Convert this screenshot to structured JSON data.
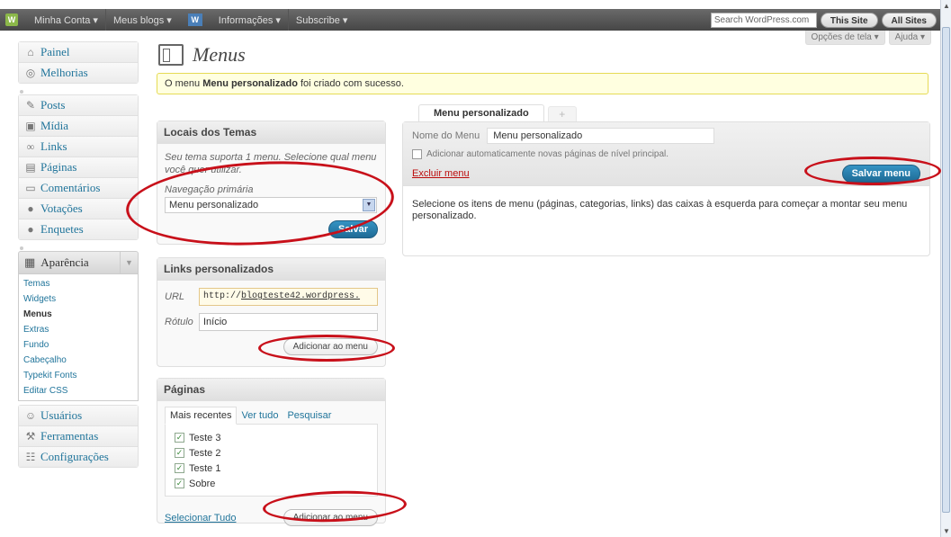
{
  "adminbar": {
    "items": [
      "Minha Conta ▾",
      "Meus blogs ▾",
      "Informações ▾",
      "Subscribe ▾"
    ],
    "search_placeholder": "Search WordPress.com",
    "this_site": "This Site",
    "all_sites": "All Sites"
  },
  "screen_options": {
    "opts": "Opções de tela ▾",
    "help": "Ajuda ▾"
  },
  "sidebar": {
    "group1": [
      "Painel",
      "Melhorias"
    ],
    "group2": [
      "Posts",
      "Mídia",
      "Links",
      "Páginas",
      "Comentários",
      "Votações",
      "Enquetes"
    ],
    "appearance": "Aparência",
    "submenu": [
      "Temas",
      "Widgets",
      "Menus",
      "Extras",
      "Fundo",
      "Cabeçalho",
      "Typekit Fonts",
      "Editar CSS"
    ],
    "group3": [
      "Usuários",
      "Ferramentas",
      "Configurações"
    ]
  },
  "page": {
    "title": "Menus",
    "notice_pre": "O menu ",
    "notice_bold": "Menu personalizado",
    "notice_post": " foi criado com sucesso."
  },
  "locations": {
    "title": "Locais dos Temas",
    "desc": "Seu tema suporta 1 menu. Selecione qual menu você quer utilizar.",
    "label": "Navegação primária",
    "selected": "Menu personalizado",
    "save": "Salvar"
  },
  "custom_links": {
    "title": "Links personalizados",
    "url_label": "URL",
    "url_prefix": "http://",
    "url_link": "blogteste42.wordpress.",
    "label_label": "Rótulo",
    "label_value": "Início",
    "add": "Adicionar ao menu"
  },
  "pages_box": {
    "title": "Páginas",
    "tabs": [
      "Mais recentes",
      "Ver tudo",
      "Pesquisar"
    ],
    "items": [
      "Teste 3",
      "Teste 2",
      "Teste 1",
      "Sobre"
    ],
    "select_all": "Selecionar Tudo",
    "add": "Adicionar ao menu"
  },
  "menu_editor": {
    "tab": "Menu personalizado",
    "plus": "+",
    "name_label": "Nome do Menu",
    "name_value": "Menu personalizado",
    "auto_add": "Adicionar automaticamente novas páginas de nível principal.",
    "delete": "Excluir menu",
    "save": "Salvar menu",
    "instructions": "Selecione os itens de menu (páginas, categorias, links) das caixas à esquerda para começar a montar seu menu personalizado."
  },
  "colors": {
    "accent": "#21759b",
    "annotation": "#c8101a",
    "notice_bg": "#ffffe0"
  }
}
